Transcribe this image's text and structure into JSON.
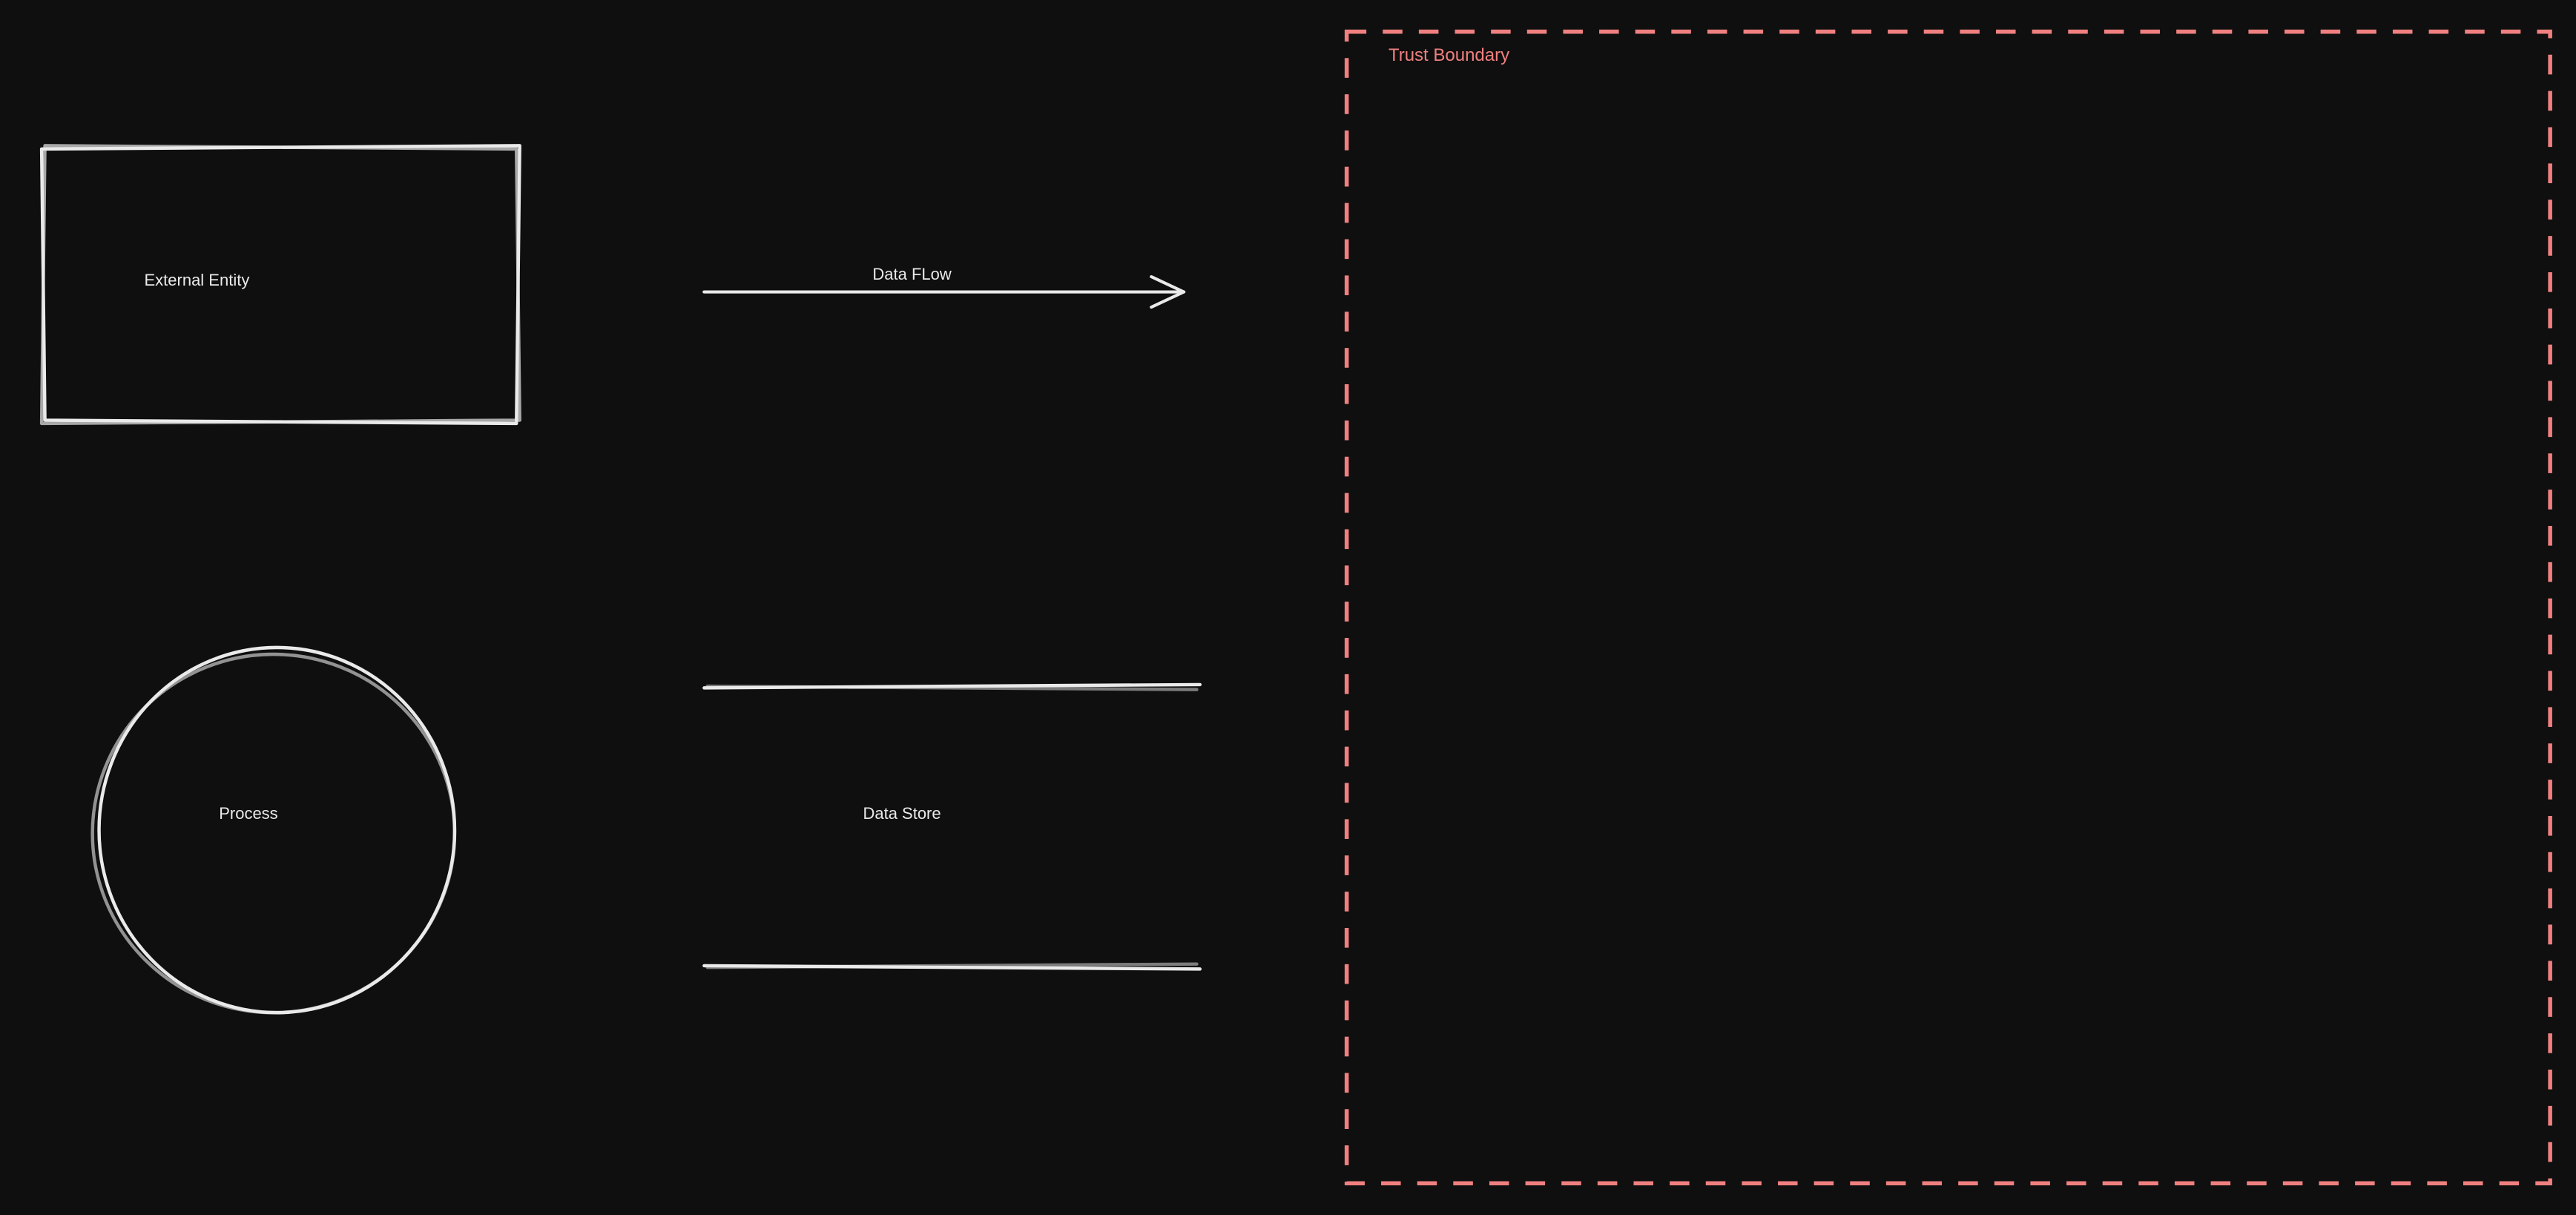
{
  "diagram": {
    "external_entity": {
      "label": "External Entity"
    },
    "process": {
      "label": "Process"
    },
    "data_flow": {
      "label": "Data FLow"
    },
    "data_store": {
      "label": "Data Store"
    },
    "trust_boundary": {
      "label": "Trust Boundary"
    }
  },
  "colors": {
    "background": "#0f0f0f",
    "stroke": "#eaeaea",
    "boundary": "#f08080"
  }
}
